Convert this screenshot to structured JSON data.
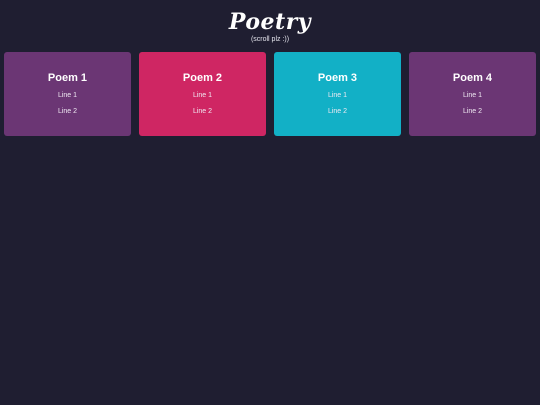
{
  "header": {
    "title": "Poetry",
    "subtitle": "(scroll plz :))"
  },
  "poems": [
    {
      "title": "Poem 1",
      "line1": "Line 1",
      "line2": "Line 2",
      "color": "#6b3674"
    },
    {
      "title": "Poem 2",
      "line1": "Line 1",
      "line2": "Line 2",
      "color": "#cf2663"
    },
    {
      "title": "Poem 3",
      "line1": "Line 1",
      "line2": "Line 2",
      "color": "#12b0c6"
    },
    {
      "title": "Poem 4",
      "line1": "Line 1",
      "line2": "Line 2",
      "color": "#6b3674"
    }
  ]
}
